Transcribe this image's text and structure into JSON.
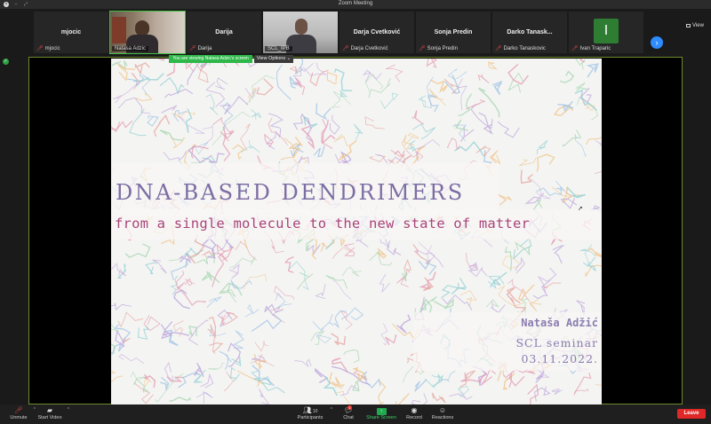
{
  "window": {
    "title": "Zoom Meeting"
  },
  "participants": [
    {
      "name": "mjocic",
      "label": "mjocic",
      "video": false,
      "muted": true
    },
    {
      "name": "Natasa Adzic",
      "label": "Natasa Adzic",
      "video": true,
      "muted": false,
      "active": true
    },
    {
      "name": "Darija",
      "label": "Darija",
      "video": false,
      "muted": true
    },
    {
      "name": "SCL_IPB",
      "label": "SCL_IPB",
      "video": true,
      "muted": false
    },
    {
      "name": "Darja Cvetković",
      "label": "Darja Cvetković",
      "video": false,
      "muted": true
    },
    {
      "name": "Sonja Predin",
      "label": "Sonja Predin",
      "video": false,
      "muted": true
    },
    {
      "name": "Darko Tanask...",
      "label": "Darko Tanaskovic",
      "video": false,
      "muted": true
    },
    {
      "name": "I",
      "label": "Ivan Traparic",
      "video": false,
      "muted": true,
      "avatar_color": "#2e7d32"
    }
  ],
  "view_button": "View",
  "viewing_banner": "You are viewing Natasa Adzic's screen",
  "view_options": "View Options",
  "slide": {
    "title": "DNA-BASED DENDRIMERS",
    "subtitle": "from a single molecule to the new state of matter",
    "author": "Nataša Adžić",
    "seminar": "SCL seminar",
    "date": "03.11.2022."
  },
  "toolbar": {
    "unmute": "Unmute",
    "start_video": "Start Video",
    "participants": "Participants",
    "participants_count": "10",
    "chat": "Chat",
    "chat_badge": "1",
    "share_screen": "Share Screen",
    "record": "Record",
    "reactions": "Reactions",
    "leave": "Leave"
  },
  "colors": {
    "accent_blue": "#2d8cff",
    "share_green": "#21a94e",
    "leave_red": "#e02828",
    "active_speaker": "#40c040"
  }
}
